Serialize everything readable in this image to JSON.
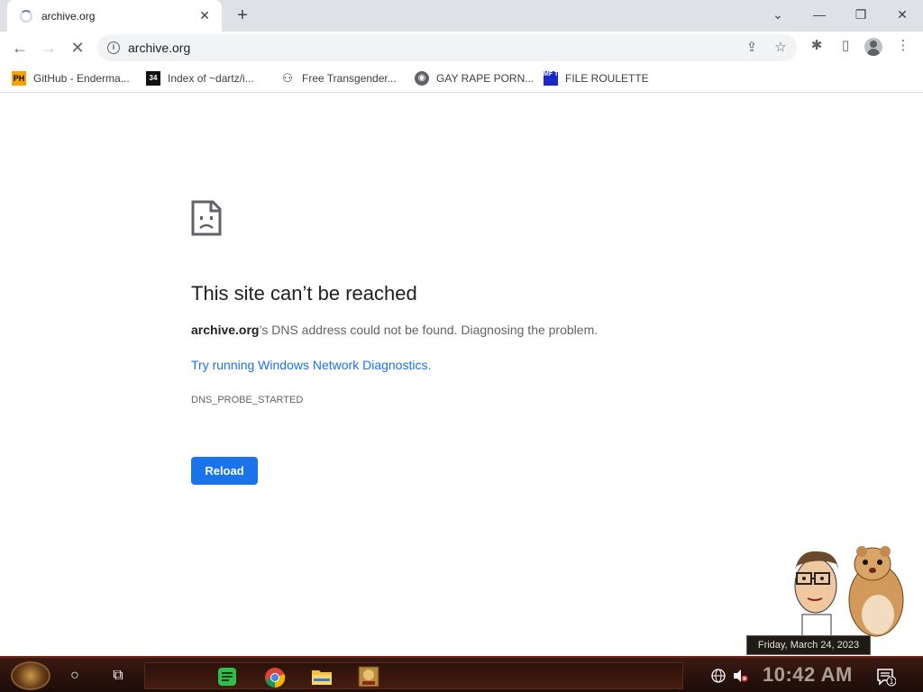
{
  "browser": {
    "tab": {
      "title": "archive.org",
      "close_glyph": "✕"
    },
    "new_tab_glyph": "+",
    "window_controls": {
      "list_tabs": "⌄",
      "minimize": "—",
      "restore": "❐",
      "close": "✕"
    },
    "nav": {
      "back": "←",
      "forward": "→",
      "stop": "✕"
    },
    "url": "archive.org",
    "omnibox_icons": {
      "info": "i",
      "share": "⇪",
      "star": "☆"
    },
    "toolbar_icons": {
      "extensions": "✱",
      "side_panel": "▯",
      "menu": "⋮"
    }
  },
  "bookmarks": [
    {
      "label": "GitHub - Enderma...",
      "icon": "ph-icon",
      "glyph": "PH"
    },
    {
      "label": "Index of ~dartz/i...",
      "icon": "index-icon",
      "glyph": "34"
    },
    {
      "label": "Free Transgender...",
      "icon": "transgender-icon",
      "glyph": "⚇"
    },
    {
      "label": "GAY RAPE PORN...",
      "icon": "globe-icon",
      "glyph": "◉"
    },
    {
      "label": "FILE ROULETTE",
      "icon": "file-roulette-icon",
      "glyph": "MF T"
    }
  ],
  "error_page": {
    "title": "This site can’t be reached",
    "host": "archive.org",
    "message_suffix": "’s DNS address could not be found. Diagnosing the problem.",
    "link_text": "Try running Windows Network Diagnostics",
    "link_suffix": ".",
    "error_code": "DNS_PROBE_STARTED",
    "reload_label": "Reload"
  },
  "desktop": {
    "date_tooltip": "Friday, March 24, 2023"
  },
  "taskbar": {
    "clock": "10:42 AM",
    "notification_count": "1",
    "search_glyph": "○",
    "taskview_glyph": "⧉"
  },
  "colors": {
    "accent": "#1a73e8",
    "tabstrip": "#dee1e6",
    "taskbar": "#2a1209"
  }
}
